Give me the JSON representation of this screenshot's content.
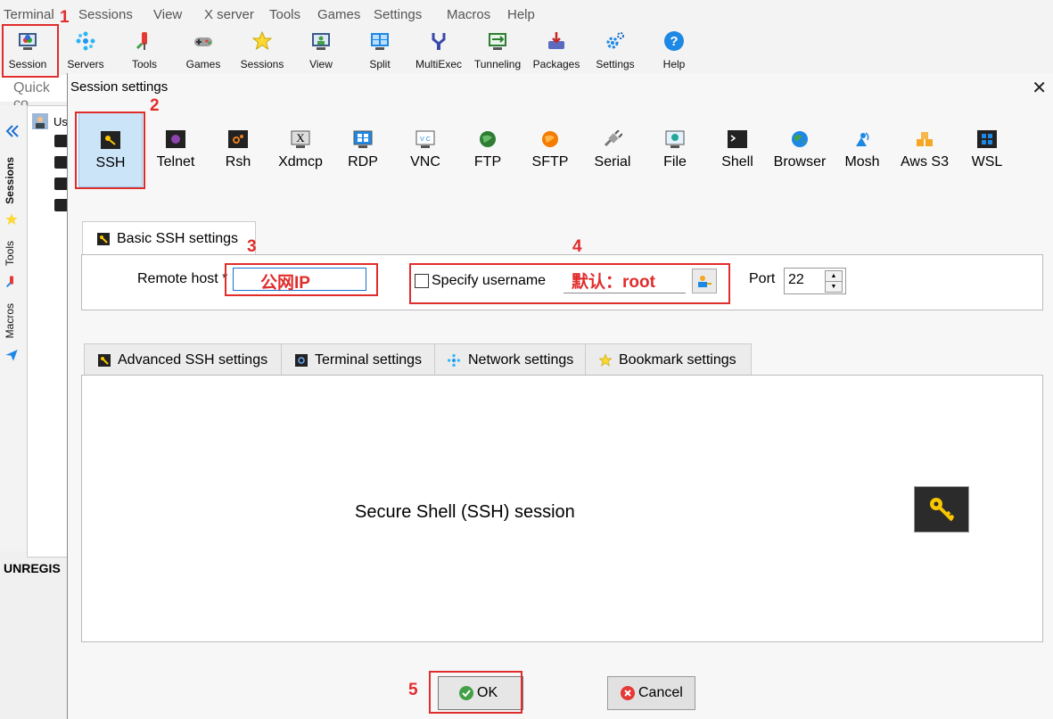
{
  "menu": [
    "Terminal",
    "Sessions",
    "View",
    "X server",
    "Tools",
    "Games",
    "Settings",
    "Macros",
    "Help"
  ],
  "toolbar": [
    {
      "label": "Session",
      "icon": "session-icon"
    },
    {
      "label": "Servers",
      "icon": "servers-icon"
    },
    {
      "label": "Tools",
      "icon": "tools-icon"
    },
    {
      "label": "Games",
      "icon": "games-icon"
    },
    {
      "label": "Sessions",
      "icon": "sessions-star-icon"
    },
    {
      "label": "View",
      "icon": "view-icon"
    },
    {
      "label": "Split",
      "icon": "split-icon"
    },
    {
      "label": "MultiExec",
      "icon": "multiexec-icon"
    },
    {
      "label": "Tunneling",
      "icon": "tunneling-icon"
    },
    {
      "label": "Packages",
      "icon": "packages-icon"
    },
    {
      "label": "Settings",
      "icon": "settings-icon"
    },
    {
      "label": "Help",
      "icon": "help-icon"
    }
  ],
  "quick_connect": {
    "placeholder": "Quick co"
  },
  "side_tabs": [
    "Sessions",
    "Tools",
    "Macros"
  ],
  "side_panel": {
    "user_item": "Us"
  },
  "status": {
    "unregistered": "UNREGIS"
  },
  "dialog": {
    "title": "Session settings",
    "session_types": [
      "SSH",
      "Telnet",
      "Rsh",
      "Xdmcp",
      "RDP",
      "VNC",
      "FTP",
      "SFTP",
      "Serial",
      "File",
      "Shell",
      "Browser",
      "Mosh",
      "Aws S3",
      "WSL"
    ],
    "selected_type": "SSH",
    "basic_tab": "Basic SSH settings",
    "remote_host_label": "Remote host *",
    "remote_host_value": "公网IP",
    "specify_username_label": "Specify username",
    "specify_username_checked": false,
    "username_value": "默认：root",
    "port_label": "Port",
    "port_value": "22",
    "tabs": [
      "Advanced SSH settings",
      "Terminal settings",
      "Network settings",
      "Bookmark settings"
    ],
    "description": "Secure Shell (SSH) session",
    "ok_label": "OK",
    "cancel_label": "Cancel"
  },
  "annotations": [
    "1",
    "2",
    "3",
    "4",
    "5"
  ],
  "colors": {
    "annotation": "#e12c2c",
    "selected_bg": "#cce4f7",
    "accent": "#1a6fd1"
  }
}
